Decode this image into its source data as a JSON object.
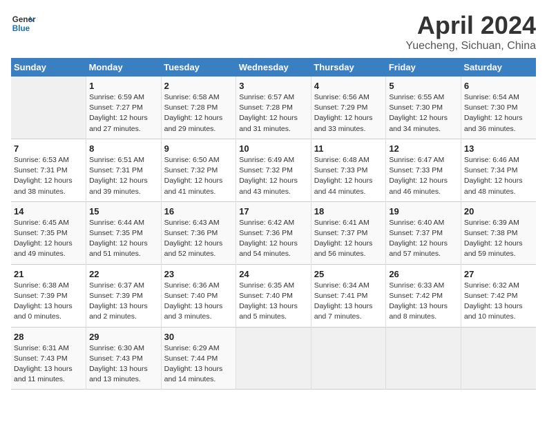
{
  "logo": {
    "line1": "General",
    "line2": "Blue"
  },
  "title": "April 2024",
  "location": "Yuecheng, Sichuan, China",
  "days_header": [
    "Sunday",
    "Monday",
    "Tuesday",
    "Wednesday",
    "Thursday",
    "Friday",
    "Saturday"
  ],
  "weeks": [
    [
      {
        "num": "",
        "info": ""
      },
      {
        "num": "1",
        "info": "Sunrise: 6:59 AM\nSunset: 7:27 PM\nDaylight: 12 hours\nand 27 minutes."
      },
      {
        "num": "2",
        "info": "Sunrise: 6:58 AM\nSunset: 7:28 PM\nDaylight: 12 hours\nand 29 minutes."
      },
      {
        "num": "3",
        "info": "Sunrise: 6:57 AM\nSunset: 7:28 PM\nDaylight: 12 hours\nand 31 minutes."
      },
      {
        "num": "4",
        "info": "Sunrise: 6:56 AM\nSunset: 7:29 PM\nDaylight: 12 hours\nand 33 minutes."
      },
      {
        "num": "5",
        "info": "Sunrise: 6:55 AM\nSunset: 7:30 PM\nDaylight: 12 hours\nand 34 minutes."
      },
      {
        "num": "6",
        "info": "Sunrise: 6:54 AM\nSunset: 7:30 PM\nDaylight: 12 hours\nand 36 minutes."
      }
    ],
    [
      {
        "num": "7",
        "info": "Sunrise: 6:53 AM\nSunset: 7:31 PM\nDaylight: 12 hours\nand 38 minutes."
      },
      {
        "num": "8",
        "info": "Sunrise: 6:51 AM\nSunset: 7:31 PM\nDaylight: 12 hours\nand 39 minutes."
      },
      {
        "num": "9",
        "info": "Sunrise: 6:50 AM\nSunset: 7:32 PM\nDaylight: 12 hours\nand 41 minutes."
      },
      {
        "num": "10",
        "info": "Sunrise: 6:49 AM\nSunset: 7:32 PM\nDaylight: 12 hours\nand 43 minutes."
      },
      {
        "num": "11",
        "info": "Sunrise: 6:48 AM\nSunset: 7:33 PM\nDaylight: 12 hours\nand 44 minutes."
      },
      {
        "num": "12",
        "info": "Sunrise: 6:47 AM\nSunset: 7:33 PM\nDaylight: 12 hours\nand 46 minutes."
      },
      {
        "num": "13",
        "info": "Sunrise: 6:46 AM\nSunset: 7:34 PM\nDaylight: 12 hours\nand 48 minutes."
      }
    ],
    [
      {
        "num": "14",
        "info": "Sunrise: 6:45 AM\nSunset: 7:35 PM\nDaylight: 12 hours\nand 49 minutes."
      },
      {
        "num": "15",
        "info": "Sunrise: 6:44 AM\nSunset: 7:35 PM\nDaylight: 12 hours\nand 51 minutes."
      },
      {
        "num": "16",
        "info": "Sunrise: 6:43 AM\nSunset: 7:36 PM\nDaylight: 12 hours\nand 52 minutes."
      },
      {
        "num": "17",
        "info": "Sunrise: 6:42 AM\nSunset: 7:36 PM\nDaylight: 12 hours\nand 54 minutes."
      },
      {
        "num": "18",
        "info": "Sunrise: 6:41 AM\nSunset: 7:37 PM\nDaylight: 12 hours\nand 56 minutes."
      },
      {
        "num": "19",
        "info": "Sunrise: 6:40 AM\nSunset: 7:37 PM\nDaylight: 12 hours\nand 57 minutes."
      },
      {
        "num": "20",
        "info": "Sunrise: 6:39 AM\nSunset: 7:38 PM\nDaylight: 12 hours\nand 59 minutes."
      }
    ],
    [
      {
        "num": "21",
        "info": "Sunrise: 6:38 AM\nSunset: 7:39 PM\nDaylight: 13 hours\nand 0 minutes."
      },
      {
        "num": "22",
        "info": "Sunrise: 6:37 AM\nSunset: 7:39 PM\nDaylight: 13 hours\nand 2 minutes."
      },
      {
        "num": "23",
        "info": "Sunrise: 6:36 AM\nSunset: 7:40 PM\nDaylight: 13 hours\nand 3 minutes."
      },
      {
        "num": "24",
        "info": "Sunrise: 6:35 AM\nSunset: 7:40 PM\nDaylight: 13 hours\nand 5 minutes."
      },
      {
        "num": "25",
        "info": "Sunrise: 6:34 AM\nSunset: 7:41 PM\nDaylight: 13 hours\nand 7 minutes."
      },
      {
        "num": "26",
        "info": "Sunrise: 6:33 AM\nSunset: 7:42 PM\nDaylight: 13 hours\nand 8 minutes."
      },
      {
        "num": "27",
        "info": "Sunrise: 6:32 AM\nSunset: 7:42 PM\nDaylight: 13 hours\nand 10 minutes."
      }
    ],
    [
      {
        "num": "28",
        "info": "Sunrise: 6:31 AM\nSunset: 7:43 PM\nDaylight: 13 hours\nand 11 minutes."
      },
      {
        "num": "29",
        "info": "Sunrise: 6:30 AM\nSunset: 7:43 PM\nDaylight: 13 hours\nand 13 minutes."
      },
      {
        "num": "30",
        "info": "Sunrise: 6:29 AM\nSunset: 7:44 PM\nDaylight: 13 hours\nand 14 minutes."
      },
      {
        "num": "",
        "info": ""
      },
      {
        "num": "",
        "info": ""
      },
      {
        "num": "",
        "info": ""
      },
      {
        "num": "",
        "info": ""
      }
    ]
  ]
}
